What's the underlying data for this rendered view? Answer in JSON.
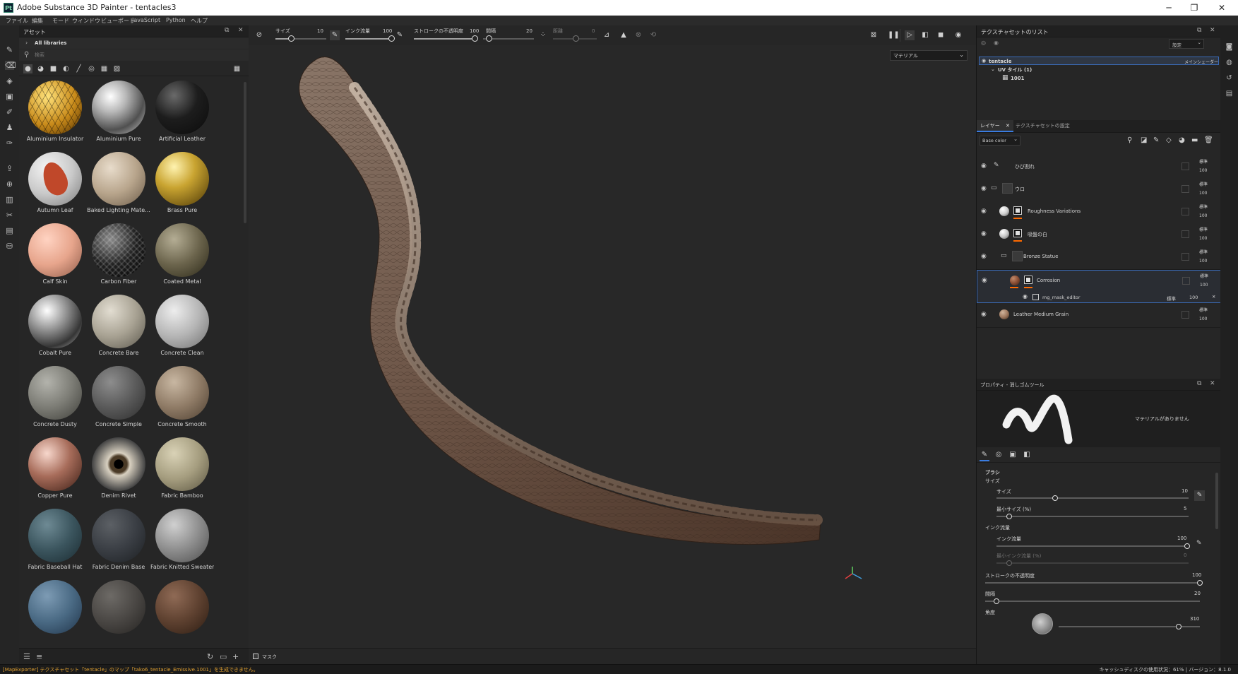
{
  "window": {
    "title": "Adobe Substance 3D Painter - tentacles3",
    "app_icon": "Pt"
  },
  "menu": [
    "ファイル",
    "編集",
    "モード",
    "ウィンドウ",
    "ビューポート",
    "JavaScript",
    "Python",
    "ヘルプ"
  ],
  "assets": {
    "title": "アセット",
    "library": "All libraries",
    "search_placeholder": "検索",
    "materials": [
      {
        "name": "Aluminium Insulator"
      },
      {
        "name": "Aluminium Pure"
      },
      {
        "name": "Artificial Leather"
      },
      {
        "name": "Autumn Leaf"
      },
      {
        "name": "Baked Lighting Mate..."
      },
      {
        "name": "Brass Pure"
      },
      {
        "name": "Calf Skin"
      },
      {
        "name": "Carbon Fiber"
      },
      {
        "name": "Coated Metal"
      },
      {
        "name": "Cobalt Pure"
      },
      {
        "name": "Concrete Bare"
      },
      {
        "name": "Concrete Clean"
      },
      {
        "name": "Concrete Dusty"
      },
      {
        "name": "Concrete Simple"
      },
      {
        "name": "Concrete Smooth"
      },
      {
        "name": "Copper Pure"
      },
      {
        "name": "Denim Rivet"
      },
      {
        "name": "Fabric Bamboo"
      },
      {
        "name": "Fabric Baseball Hat"
      },
      {
        "name": "Fabric Denim Base"
      },
      {
        "name": "Fabric Knitted Sweater"
      },
      {
        "name": ""
      },
      {
        "name": ""
      },
      {
        "name": ""
      }
    ]
  },
  "toolbar": {
    "size_label": "サイズ",
    "size_value": "10",
    "flow_label": "インク流量",
    "flow_value": "100",
    "stroke_opacity_label": "ストロークの不透明度",
    "stroke_opacity_value": "100",
    "spacing_label": "間隔",
    "spacing_value": "20",
    "jitter_label": "距離",
    "jitter_value": "0"
  },
  "viewport": {
    "mode_select": "マテリアル",
    "mask_label": "マスク"
  },
  "texture_set_list": {
    "title": "テクスチャセットのリスト",
    "settings": "設定",
    "set_name": "tentacle",
    "shader": "メインシェーダー",
    "uv_tile": "UV タイル (1)",
    "tile": "1001"
  },
  "layers": {
    "tab_layers": "レイヤー",
    "tab_settings": "テクスチャセットの設定",
    "channel": "Base color",
    "items": [
      {
        "name": "ひび割れ",
        "blend": "標準",
        "opacity": "100"
      },
      {
        "name": "ウロ",
        "blend": "標準",
        "opacity": "100"
      },
      {
        "name": "Roughness Variations",
        "blend": "標準",
        "opacity": "100"
      },
      {
        "name": "吸盤の白",
        "blend": "標準",
        "opacity": "100"
      },
      {
        "name": "Bronze Statue",
        "blend": "標準",
        "opacity": "100"
      },
      {
        "name": "Corrosion",
        "blend": "標準",
        "opacity": "100"
      },
      {
        "name": "Leather Medium Grain",
        "blend": "標準",
        "opacity": "100"
      }
    ],
    "sub_effect": {
      "name": "mg_mask_editor",
      "blend": "標準",
      "opacity": "100"
    }
  },
  "properties": {
    "title": "プロパティ - 消しゴムツール",
    "no_material": "マテリアルがありません",
    "section_brush": "ブラシ",
    "size_group": "サイズ",
    "size_label": "サイズ",
    "size_value": "10",
    "min_size_label": "最小サイズ (%)",
    "min_size_value": "5",
    "flow_group": "インク流量",
    "flow_label": "インク流量",
    "flow_value": "100",
    "min_flow_label": "最小インク流量 (%)",
    "min_flow_value": "0",
    "stroke_opacity_label": "ストロークの不透明度",
    "stroke_opacity_value": "100",
    "spacing_label": "間隔",
    "spacing_value": "20",
    "angle_label": "角度",
    "angle_value": "310"
  },
  "status": {
    "message": "[MapExporter] テクスチャセット「tentacle」のマップ「tako6_tentacle_Emissive.1001」を生成できません。",
    "right": "キャッシュディスクの使用状況：61% | バージョン：8.1.0"
  }
}
